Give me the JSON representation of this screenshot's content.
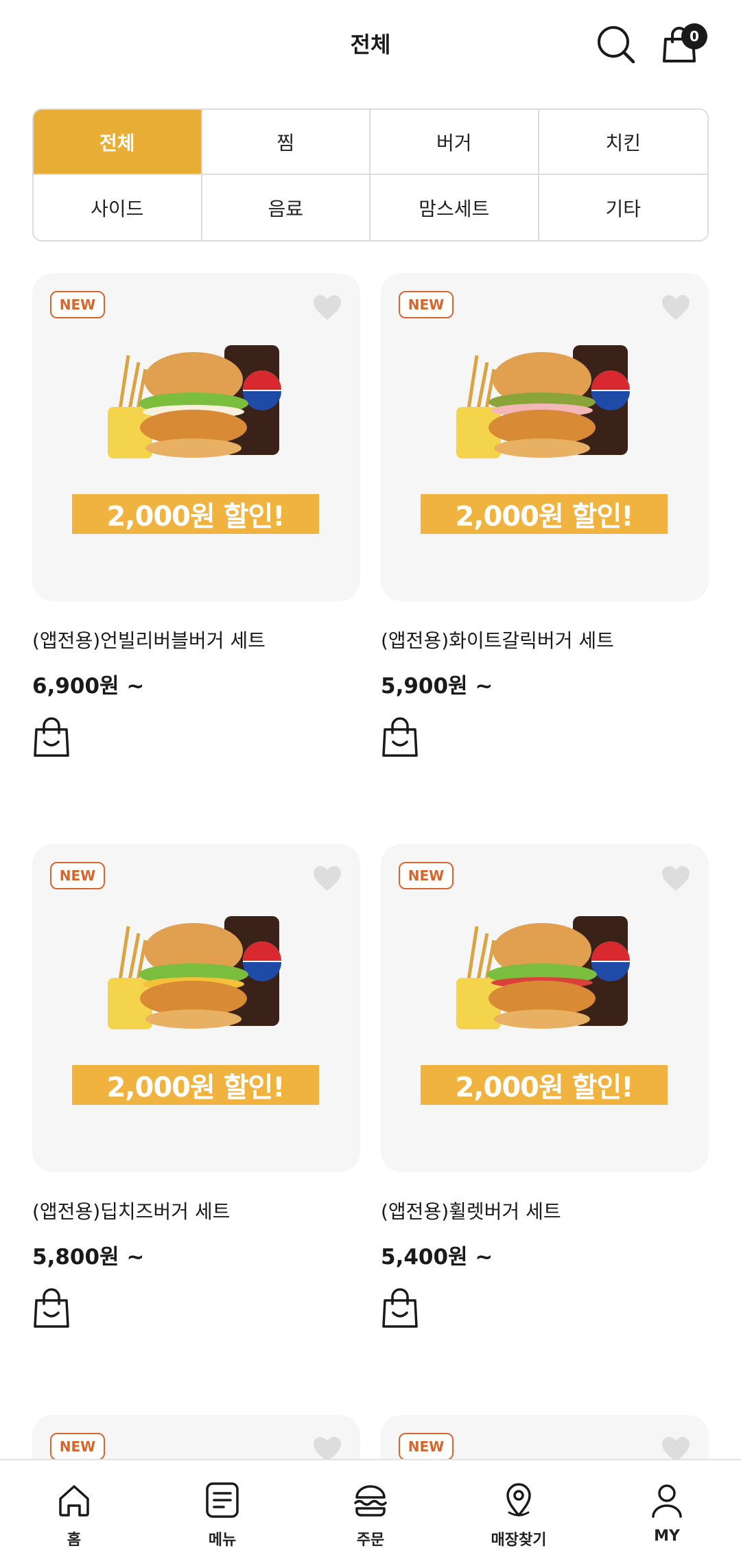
{
  "header": {
    "title": "전체",
    "cart_count": "0"
  },
  "categories": [
    {
      "label": "전체",
      "active": true
    },
    {
      "label": "찜"
    },
    {
      "label": "버거"
    },
    {
      "label": "치킨"
    },
    {
      "label": "사이드"
    },
    {
      "label": "음료"
    },
    {
      "label": "맘스세트"
    },
    {
      "label": "기타"
    }
  ],
  "products": [
    {
      "badge": "NEW",
      "promo": "2,000원 할인!",
      "name": "(앱전용)언빌리버블버거 세트",
      "price": "6,900원 ~"
    },
    {
      "badge": "NEW",
      "promo": "2,000원 할인!",
      "name": "(앱전용)화이트갈릭버거 세트",
      "price": "5,900원 ~"
    },
    {
      "badge": "NEW",
      "promo": "2,000원 할인!",
      "name": "(앱전용)딥치즈버거 세트",
      "price": "5,800원 ~"
    },
    {
      "badge": "NEW",
      "promo": "2,000원 할인!",
      "name": "(앱전용)휠렛버거 세트",
      "price": "5,400원 ~"
    },
    {
      "badge": "NEW"
    },
    {
      "badge": "NEW"
    }
  ],
  "nav": [
    {
      "label": "홈",
      "icon": "home-icon"
    },
    {
      "label": "메뉴",
      "icon": "menu-icon"
    },
    {
      "label": "주문",
      "icon": "burger-icon"
    },
    {
      "label": "매장찾기",
      "icon": "location-pin-icon"
    },
    {
      "label": "MY",
      "icon": "user-icon"
    }
  ],
  "colors": {
    "accent": "#e8ad35",
    "promo": "#f0b33f",
    "new_badge": "#d8652a"
  }
}
